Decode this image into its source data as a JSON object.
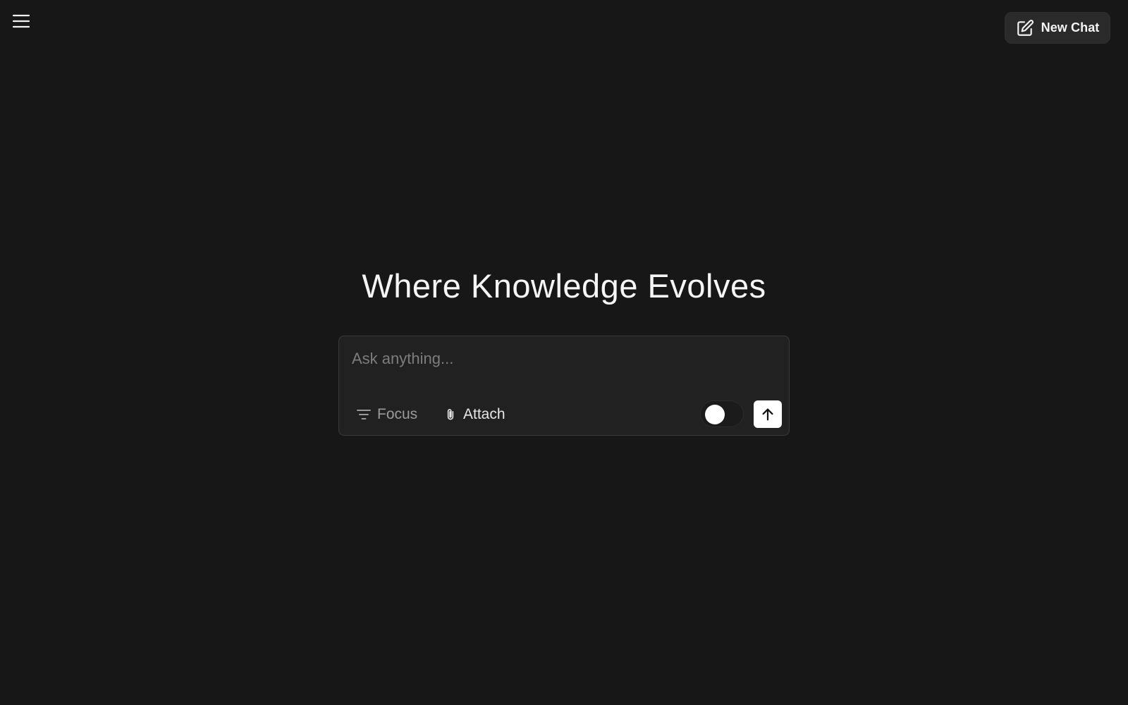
{
  "header": {
    "menu_icon": "hamburger-menu-icon",
    "new_chat": {
      "label": "New Chat",
      "icon": "edit-square-icon"
    }
  },
  "main": {
    "headline": "Where Knowledge Evolves"
  },
  "composer": {
    "input": {
      "placeholder": "Ask anything...",
      "value": ""
    },
    "focus": {
      "label": "Focus",
      "icon": "filter-lines-icon"
    },
    "attach": {
      "label": "Attach",
      "icon": "paperclip-icon"
    },
    "toggle": {
      "state": "off"
    },
    "send": {
      "icon": "arrow-up-icon"
    }
  },
  "colors": {
    "background": "#171717",
    "composer_background": "#212121",
    "button_background": "#2a2a2a",
    "text_primary": "#f5f5f5",
    "text_muted": "#9a9a9a",
    "send_background": "#ffffff"
  }
}
